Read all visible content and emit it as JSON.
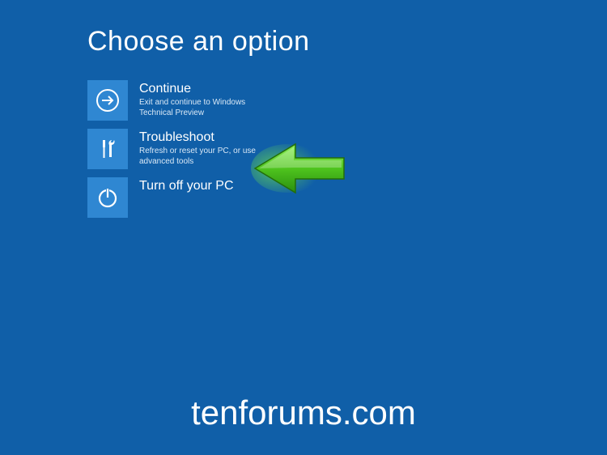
{
  "title": "Choose an option",
  "options": [
    {
      "title": "Continue",
      "desc": "Exit and continue to Windows Technical Preview"
    },
    {
      "title": "Troubleshoot",
      "desc": "Refresh or reset your PC, or use advanced tools"
    },
    {
      "title": "Turn off your PC",
      "desc": ""
    }
  ],
  "watermark": "tenforums.com"
}
